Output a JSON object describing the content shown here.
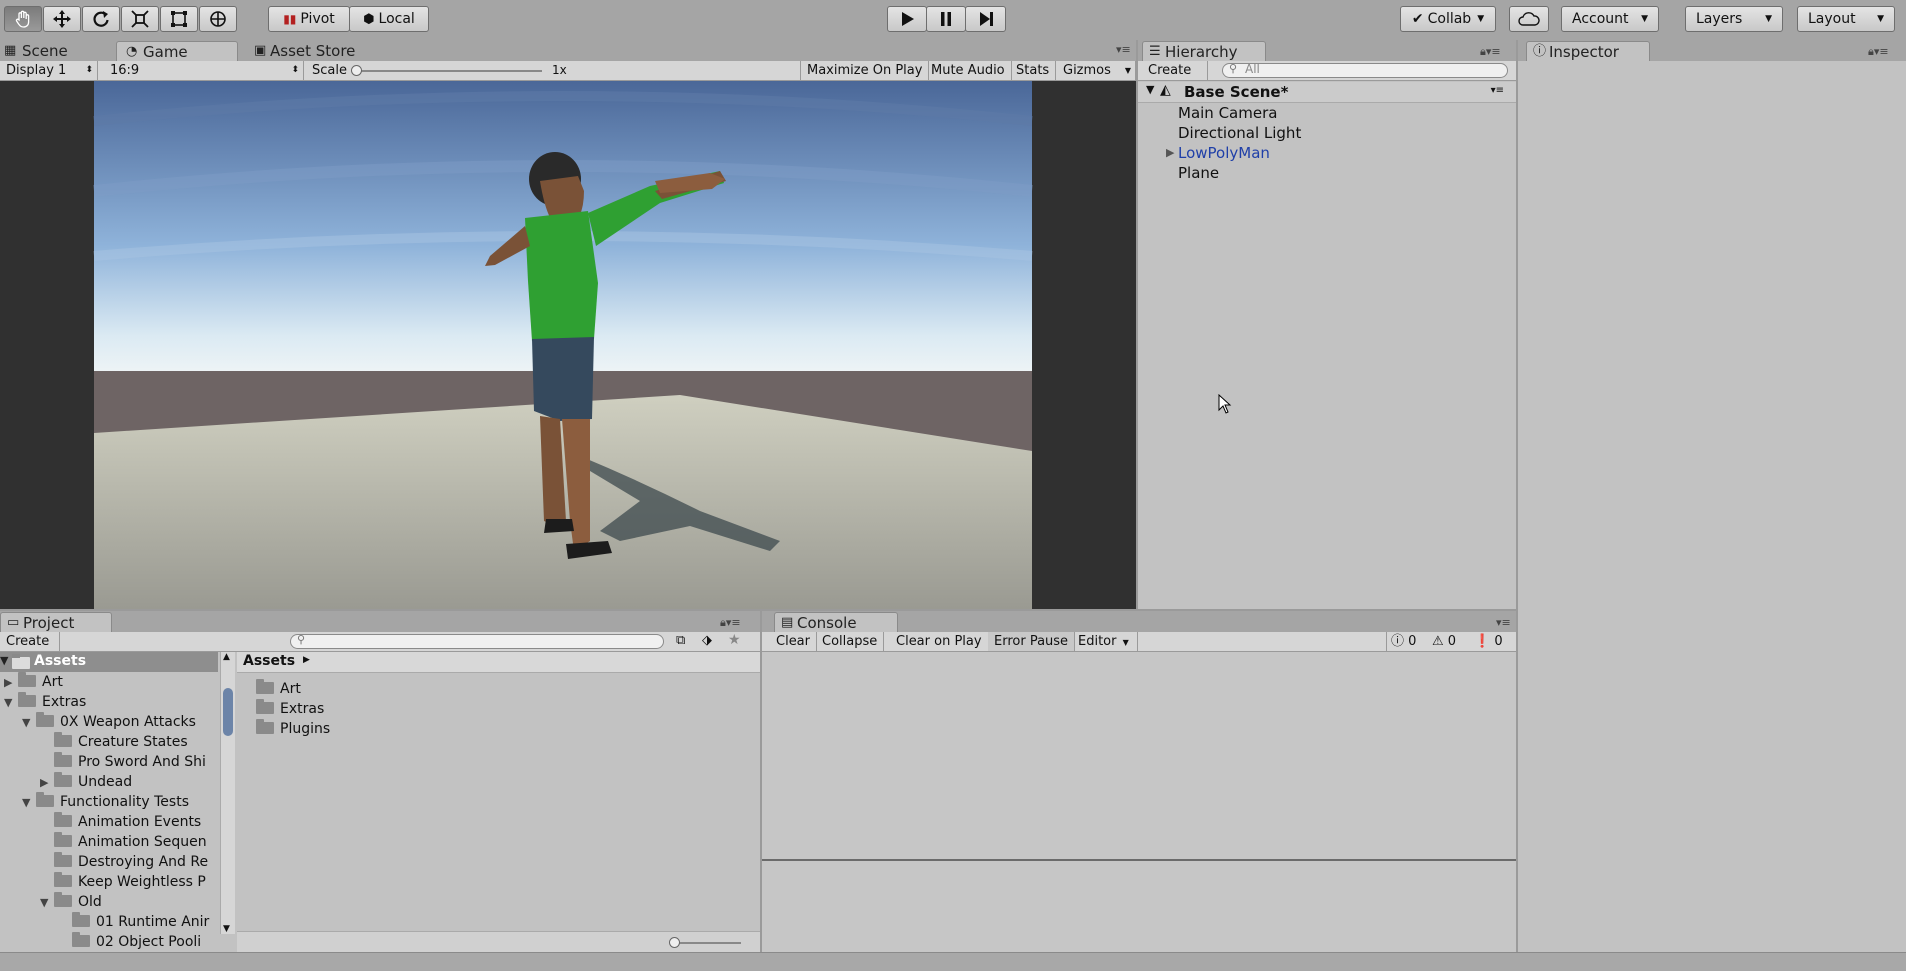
{
  "toolbar": {
    "tools": [
      "hand-tool",
      "move-tool",
      "rotate-tool",
      "scale-tool",
      "rect-tool",
      "transform-tool"
    ],
    "pivot_label": "Pivot",
    "local_label": "Local",
    "collab_label": "Collab",
    "account_label": "Account",
    "layers_label": "Layers",
    "layout_label": "Layout"
  },
  "game_view": {
    "tabs": [
      {
        "label": "Scene",
        "selected": false
      },
      {
        "label": "Game",
        "selected": true
      },
      {
        "label": "Asset Store",
        "selected": false
      }
    ],
    "display": "Display 1",
    "aspect": "16:9",
    "scale_label": "Scale",
    "scale_value": "1x",
    "scale_level": 0,
    "buttons": [
      "Maximize On Play",
      "Mute Audio",
      "Stats",
      "Gizmos"
    ]
  },
  "hierarchy": {
    "tab_label": "Hierarchy",
    "create_label": "Create",
    "search_placeholder": "All",
    "scene_name": "Base Scene*",
    "items": [
      {
        "label": "Main Camera",
        "has_children": false,
        "prefab": false
      },
      {
        "label": "Directional Light",
        "has_children": false,
        "prefab": false
      },
      {
        "label": "LowPolyMan",
        "has_children": true,
        "prefab": true
      },
      {
        "label": "Plane",
        "has_children": false,
        "prefab": false
      }
    ]
  },
  "inspector": {
    "tab_label": "Inspector"
  },
  "project": {
    "tab_label": "Project",
    "create_label": "Create",
    "root_label": "Assets",
    "tree": [
      {
        "label": "Art",
        "depth": 1,
        "arrow": "right"
      },
      {
        "label": "Extras",
        "depth": 1,
        "arrow": "down"
      },
      {
        "label": "0X Weapon Attacks",
        "depth": 2,
        "arrow": "down"
      },
      {
        "label": "Creature States",
        "depth": 3,
        "arrow": ""
      },
      {
        "label": "Pro Sword And Shi",
        "depth": 3,
        "arrow": ""
      },
      {
        "label": "Undead",
        "depth": 3,
        "arrow": "right"
      },
      {
        "label": "Functionality Tests",
        "depth": 2,
        "arrow": "down"
      },
      {
        "label": "Animation Events",
        "depth": 3,
        "arrow": ""
      },
      {
        "label": "Animation Sequen",
        "depth": 3,
        "arrow": ""
      },
      {
        "label": "Destroying And Re",
        "depth": 3,
        "arrow": ""
      },
      {
        "label": "Keep Weightless P",
        "depth": 3,
        "arrow": ""
      },
      {
        "label": "Old",
        "depth": 3,
        "arrow": "down"
      },
      {
        "label": "01 Runtime Anir",
        "depth": 4,
        "arrow": ""
      },
      {
        "label": "02 Object Pooli",
        "depth": 4,
        "arrow": ""
      }
    ],
    "breadcrumb": "Assets",
    "contents": [
      "Art",
      "Extras",
      "Plugins"
    ]
  },
  "console": {
    "tab_label": "Console",
    "buttons": [
      "Clear",
      "Collapse",
      "Clear on Play",
      "Error Pause",
      "Editor"
    ],
    "info_count": "0",
    "warning_count": "0",
    "error_count": "0"
  },
  "colors": {
    "toolbar_bg": "#a5a5a5",
    "panel_bg": "#c2c2c2",
    "prefab_blue": "#1f3fa8"
  }
}
